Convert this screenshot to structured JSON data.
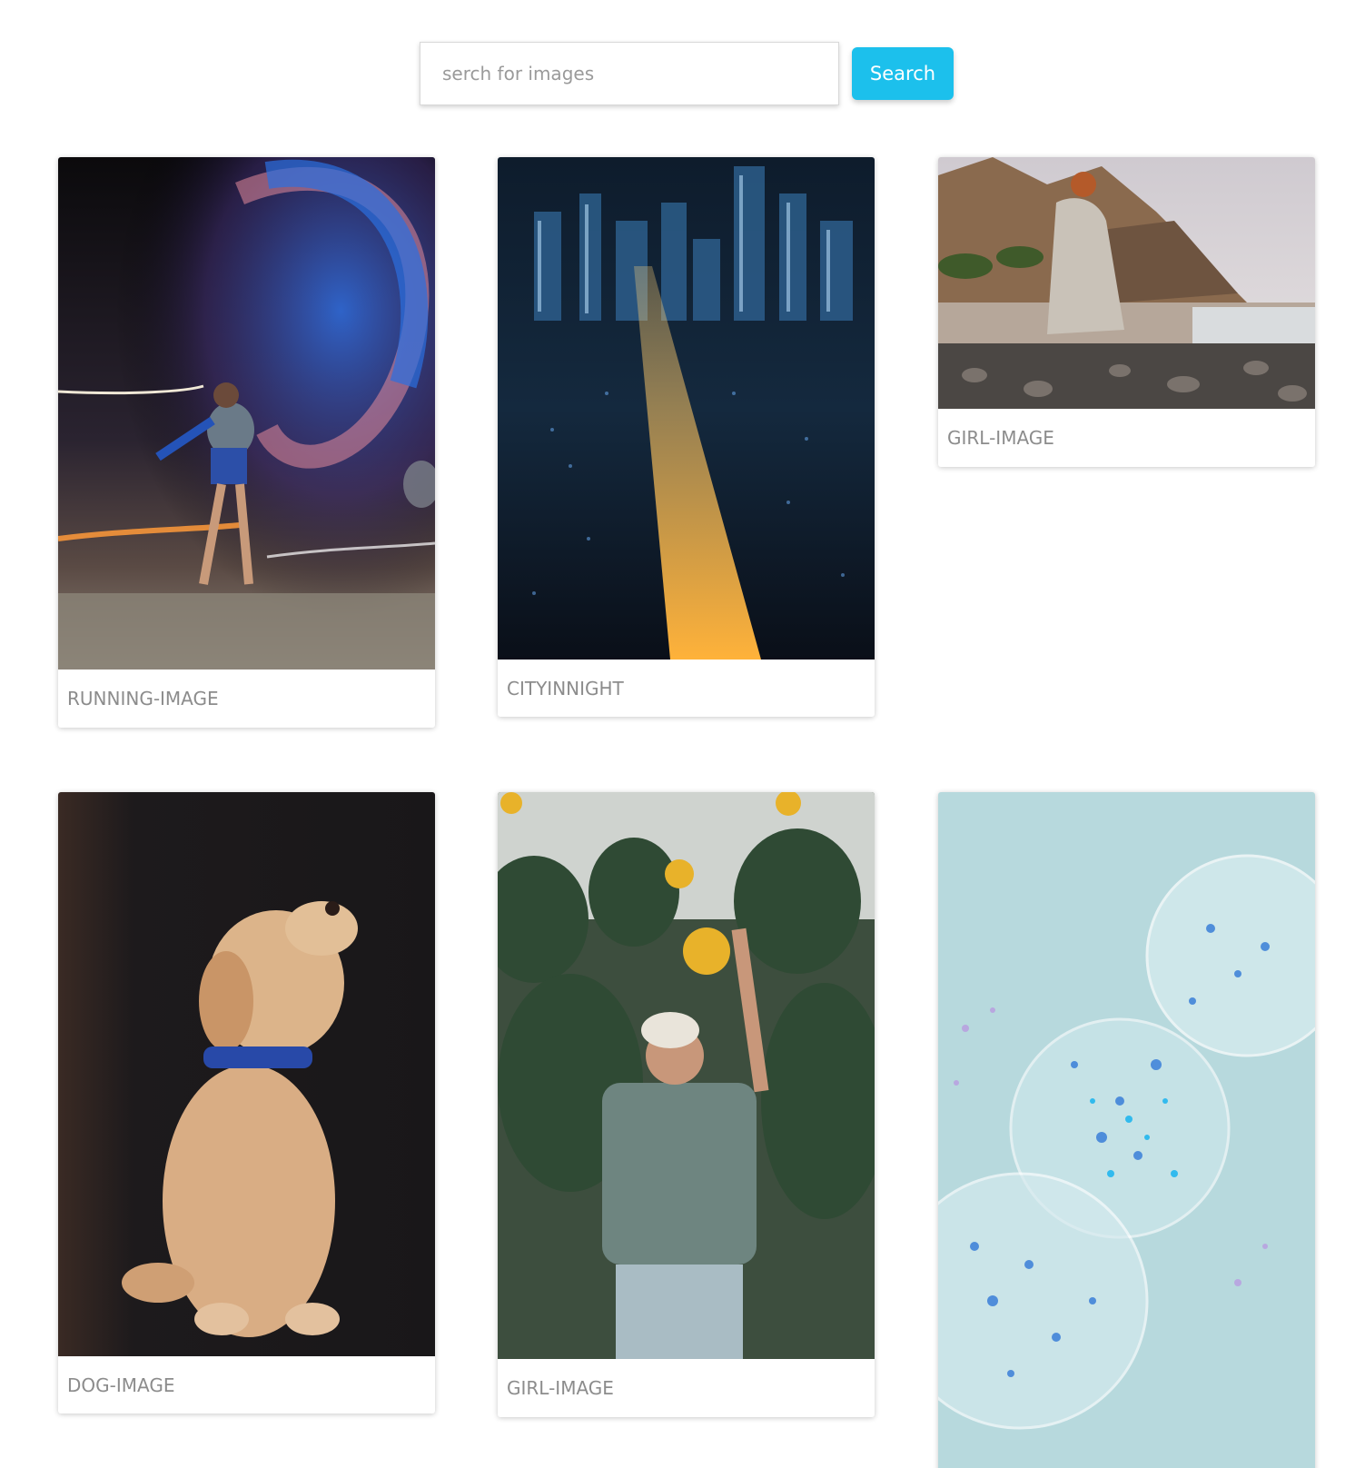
{
  "search": {
    "placeholder": "serch for images",
    "value": "",
    "button_label": "Search",
    "accent_color": "#1cc0ec"
  },
  "gallery": {
    "cards": [
      {
        "caption": "RUNNING-IMAGE",
        "subject": "night runner with light trails"
      },
      {
        "caption": "CITYINNIGHT",
        "subject": "city skyline at night"
      },
      {
        "caption": "GIRL-IMAGE",
        "subject": "woman on rocky beach"
      },
      {
        "caption": "DOG-IMAGE",
        "subject": "labrador puppy with blue collar"
      },
      {
        "caption": "GIRL-IMAGE",
        "subject": "woman among sunflowers"
      },
      {
        "caption": "",
        "subject": "glass spheres with blue particles"
      }
    ]
  }
}
